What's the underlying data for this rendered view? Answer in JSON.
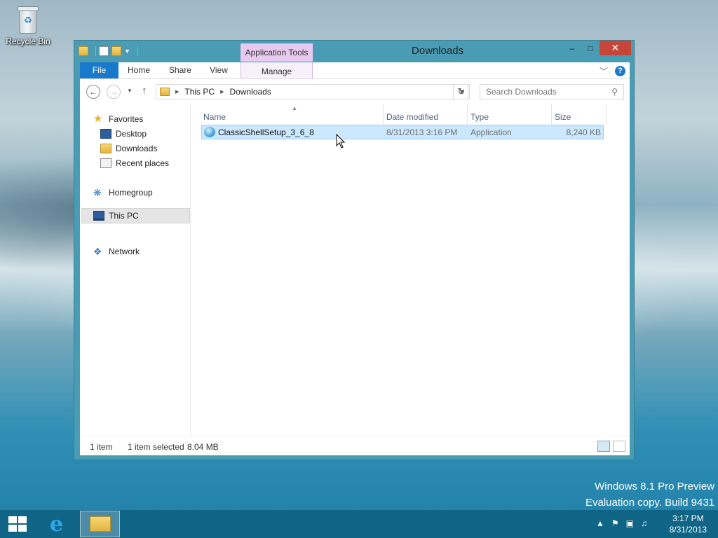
{
  "desktop": {
    "recycle_bin_label": "Recycle Bin",
    "watermark_line1": "Windows 8.1 Pro Preview",
    "watermark_line2": "Evaluation copy. Build 9431"
  },
  "window": {
    "title": "Downloads",
    "context_tab_group": "Application Tools",
    "controls": {
      "minimize": "–",
      "maximize": "□",
      "close": "✕"
    }
  },
  "ribbon": {
    "tabs": [
      "File",
      "Home",
      "Share",
      "View",
      "Manage"
    ],
    "expand_icon": "chevron-down-icon",
    "help_label": "?"
  },
  "address_bar": {
    "breadcrumb": [
      "This PC",
      "Downloads"
    ],
    "search_placeholder": "Search Downloads"
  },
  "navigation": {
    "favorites_label": "Favorites",
    "favorites": [
      "Desktop",
      "Downloads",
      "Recent places"
    ],
    "homegroup_label": "Homegroup",
    "this_pc_label": "This PC",
    "network_label": "Network",
    "selected": "This PC"
  },
  "file_list": {
    "columns": [
      "Name",
      "Date modified",
      "Type",
      "Size"
    ],
    "sort_column": "Name",
    "rows": [
      {
        "name": "ClassicShellSetup_3_6_8",
        "date_modified": "8/31/2013 3:16 PM",
        "type": "Application",
        "size": "8,240 KB",
        "selected": true
      }
    ]
  },
  "status_bar": {
    "item_count": "1 item",
    "selection": "1 item selected",
    "selection_size": "8.04 MB"
  },
  "taskbar": {
    "clock_time": "3:17 PM",
    "clock_date": "8/31/2013",
    "pinned": [
      "internet-explorer-icon",
      "file-explorer-icon"
    ]
  }
}
